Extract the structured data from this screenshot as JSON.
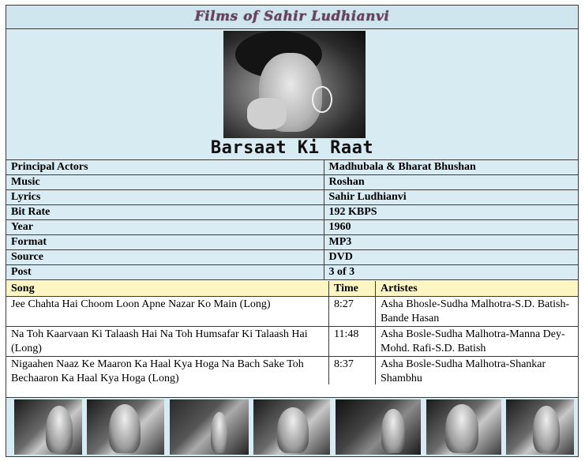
{
  "header": {
    "title": "Films of Sahir Ludhianvi"
  },
  "poster": {
    "caption": "Barsaat Ki Raat"
  },
  "info": [
    {
      "label": "Principal Actors",
      "value": "Madhubala & Bharat Bhushan"
    },
    {
      "label": "Music",
      "value": "Roshan"
    },
    {
      "label": "Lyrics",
      "value": "Sahir Ludhianvi"
    },
    {
      "label": "Bit Rate",
      "value": "192 KBPS"
    },
    {
      "label": "Year",
      "value": "1960"
    },
    {
      "label": "Format",
      "value": "MP3"
    },
    {
      "label": "Source",
      "value": "DVD"
    },
    {
      "label": "Post",
      "value": "3 of 3"
    }
  ],
  "songs": {
    "headers": {
      "song": "Song",
      "time": "Time",
      "artistes": "Artistes"
    },
    "rows": [
      {
        "song": "Jee Chahta Hai Choom Loon Apne Nazar Ko Main (Long)",
        "time": "8:27",
        "artistes": "Asha Bhosle-Sudha Malhotra-S.D. Batish-Bande Hasan"
      },
      {
        "song": "Na Toh Kaarvaan Ki Talaash Hai Na Toh Humsafar Ki Talaash Hai (Long)",
        "time": "11:48",
        "artistes": "Asha Bosle-Sudha Malhotra-Manna Dey-Mohd. Rafi-S.D. Batish"
      },
      {
        "song": "Nigaahen Naaz Ke Maaron Ka Haal Kya Hoga Na Bach Sake Toh Bechaaron Ka Haal Kya Hoga (Long)",
        "time": "8:37",
        "artistes": "Asha Bosle-Sudha Malhotra-Shankar Shambhu"
      }
    ]
  },
  "colors": {
    "title_bg": "#cfe6ef",
    "info_bg": "#d9ecf3",
    "song_header_bg": "#fdf6c3",
    "title_text": "#6a4060"
  }
}
